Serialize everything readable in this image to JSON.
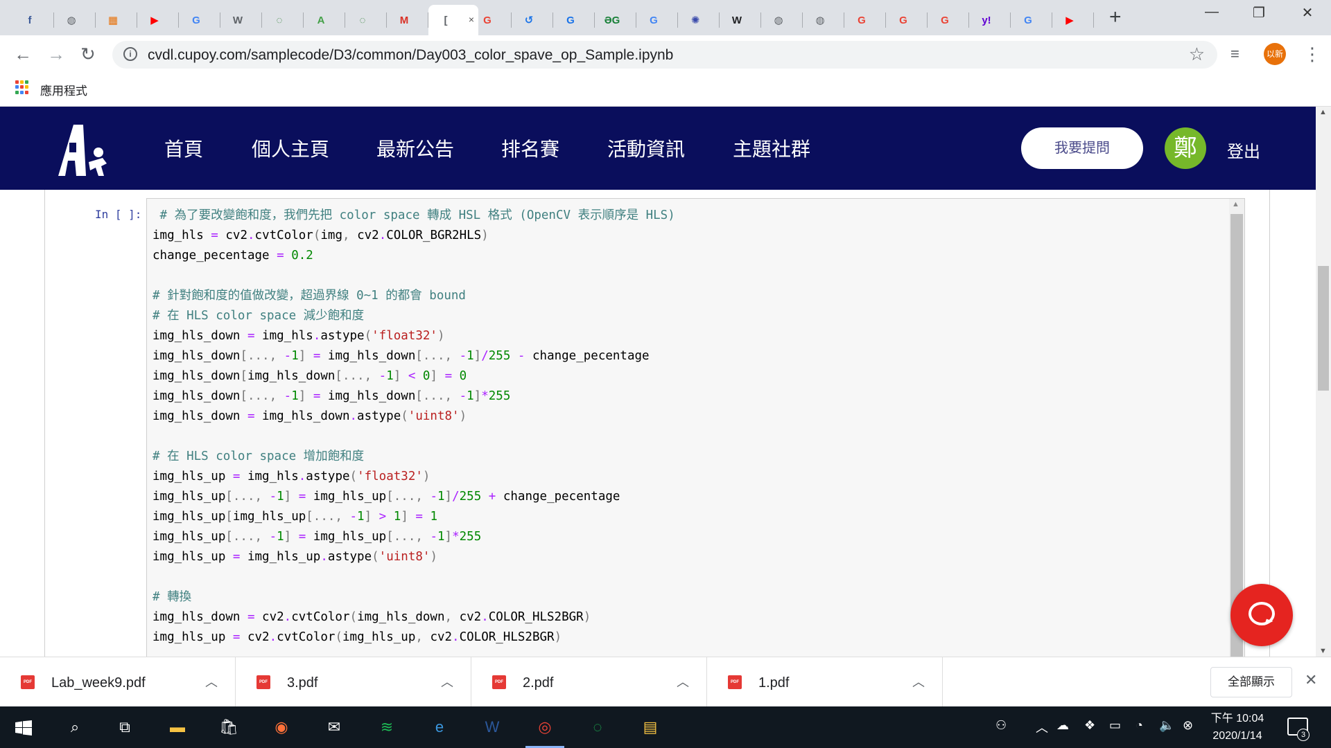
{
  "browser": {
    "tabs": [
      {
        "icon": "facebook-icon",
        "glyph": "f",
        "color": "#3b5998"
      },
      {
        "icon": "globe-icon",
        "glyph": "◍",
        "color": "#5f6368"
      },
      {
        "icon": "site-icon",
        "glyph": "▦",
        "color": "#e8710a"
      },
      {
        "icon": "youtube-icon",
        "glyph": "▶",
        "color": "#ff0000"
      },
      {
        "icon": "google-icon",
        "glyph": "G",
        "color": "#4285f4"
      },
      {
        "icon": "wordpress-icon",
        "glyph": "W",
        "color": "#5f6368"
      },
      {
        "icon": "ring-icon",
        "glyph": "◌",
        "color": "#2e7d32"
      },
      {
        "icon": "a-icon",
        "glyph": "A",
        "color": "#43a047"
      },
      {
        "icon": "ring-icon",
        "glyph": "◌",
        "color": "#2e7d32"
      },
      {
        "icon": "gmail-icon",
        "glyph": "M",
        "color": "#d93025"
      },
      {
        "icon": "active-tab-icon",
        "glyph": "[",
        "color": "#5f6368"
      },
      {
        "icon": "google-icon",
        "glyph": "G",
        "color": "#ea4335"
      },
      {
        "icon": "history-icon",
        "glyph": "↺",
        "color": "#1a73e8"
      },
      {
        "icon": "site-icon",
        "glyph": "G",
        "color": "#1a73e8"
      },
      {
        "icon": "translate-icon",
        "glyph": "ƏG",
        "color": "#188038"
      },
      {
        "icon": "google-icon",
        "glyph": "G",
        "color": "#4285f4"
      },
      {
        "icon": "settings-icon",
        "glyph": "✺",
        "color": "#3949ab"
      },
      {
        "icon": "wikipedia-icon",
        "glyph": "W",
        "color": "#202124"
      },
      {
        "icon": "globe-icon",
        "glyph": "◍",
        "color": "#5f6368"
      },
      {
        "icon": "globe-icon",
        "glyph": "◍",
        "color": "#5f6368"
      },
      {
        "icon": "google-icon",
        "glyph": "G",
        "color": "#ea4335"
      },
      {
        "icon": "google-icon",
        "glyph": "G",
        "color": "#ea4335"
      },
      {
        "icon": "google-icon",
        "glyph": "G",
        "color": "#ea4335"
      },
      {
        "icon": "yahoo-icon",
        "glyph": "y!",
        "color": "#6001d2"
      },
      {
        "icon": "google-icon",
        "glyph": "G",
        "color": "#4285f4"
      },
      {
        "icon": "youtube-icon",
        "glyph": "▶",
        "color": "#ff0000"
      }
    ],
    "active_tab_close": "×",
    "new_tab": "+",
    "url": "cvdl.cupoy.com/samplecode/D3/common/Day003_color_spave_op_Sample.ipynb",
    "profile_label": "以新",
    "bookmarks_apps_label": "應用程式"
  },
  "site": {
    "nav": [
      "首頁",
      "個人主頁",
      "最新公告",
      "排名賽",
      "活動資訊",
      "主題社群"
    ],
    "ask_button": "我要提問",
    "user_avatar": "鄭",
    "logout": "登出",
    "brand_color": "#0a0e5c"
  },
  "notebook": {
    "prompt": "In [ ]:",
    "code_lines": [
      [
        {
          "t": " # 為了要改變飽和度，我們先把 color space 轉成 HSL 格式 (OpenCV 表示順序是 HLS)",
          "c": "cm-c"
        }
      ],
      [
        {
          "t": "img_hls "
        },
        {
          "t": "=",
          "c": "cm-o"
        },
        {
          "t": " cv2"
        },
        {
          "t": ".",
          "c": "cm-o"
        },
        {
          "t": "cvtColor"
        },
        {
          "t": "(",
          "c": "cm-p"
        },
        {
          "t": "img"
        },
        {
          "t": ", ",
          "c": "cm-p"
        },
        {
          "t": "cv2"
        },
        {
          "t": ".",
          "c": "cm-o"
        },
        {
          "t": "COLOR_BGR2HLS"
        },
        {
          "t": ")",
          "c": "cm-p"
        }
      ],
      [
        {
          "t": "change_pecentage "
        },
        {
          "t": "=",
          "c": "cm-o"
        },
        {
          "t": " "
        },
        {
          "t": "0.2",
          "c": "cm-n"
        }
      ],
      [
        {
          "t": ""
        }
      ],
      [
        {
          "t": "# 針對飽和度的值做改變，超過界線 0~1 的都會 bound",
          "c": "cm-c"
        }
      ],
      [
        {
          "t": "# 在 HLS color space 減少飽和度",
          "c": "cm-c"
        }
      ],
      [
        {
          "t": "img_hls_down "
        },
        {
          "t": "=",
          "c": "cm-o"
        },
        {
          "t": " img_hls"
        },
        {
          "t": ".",
          "c": "cm-o"
        },
        {
          "t": "astype"
        },
        {
          "t": "(",
          "c": "cm-p"
        },
        {
          "t": "'float32'",
          "c": "cm-s"
        },
        {
          "t": ")",
          "c": "cm-p"
        }
      ],
      [
        {
          "t": "img_hls_down"
        },
        {
          "t": "[..., ",
          "c": "cm-p"
        },
        {
          "t": "-",
          "c": "cm-o"
        },
        {
          "t": "1",
          "c": "cm-n"
        },
        {
          "t": "]",
          "c": "cm-p"
        },
        {
          "t": " "
        },
        {
          "t": "=",
          "c": "cm-o"
        },
        {
          "t": " img_hls_down"
        },
        {
          "t": "[..., ",
          "c": "cm-p"
        },
        {
          "t": "-",
          "c": "cm-o"
        },
        {
          "t": "1",
          "c": "cm-n"
        },
        {
          "t": "]",
          "c": "cm-p"
        },
        {
          "t": "/",
          "c": "cm-o"
        },
        {
          "t": "255",
          "c": "cm-n"
        },
        {
          "t": " "
        },
        {
          "t": "-",
          "c": "cm-o"
        },
        {
          "t": " change_pecentage"
        }
      ],
      [
        {
          "t": "img_hls_down"
        },
        {
          "t": "[",
          "c": "cm-p"
        },
        {
          "t": "img_hls_down"
        },
        {
          "t": "[..., ",
          "c": "cm-p"
        },
        {
          "t": "-",
          "c": "cm-o"
        },
        {
          "t": "1",
          "c": "cm-n"
        },
        {
          "t": "]",
          "c": "cm-p"
        },
        {
          "t": " "
        },
        {
          "t": "<",
          "c": "cm-o"
        },
        {
          "t": " "
        },
        {
          "t": "0",
          "c": "cm-n"
        },
        {
          "t": "]",
          "c": "cm-p"
        },
        {
          "t": " "
        },
        {
          "t": "=",
          "c": "cm-o"
        },
        {
          "t": " "
        },
        {
          "t": "0",
          "c": "cm-n"
        }
      ],
      [
        {
          "t": "img_hls_down"
        },
        {
          "t": "[..., ",
          "c": "cm-p"
        },
        {
          "t": "-",
          "c": "cm-o"
        },
        {
          "t": "1",
          "c": "cm-n"
        },
        {
          "t": "]",
          "c": "cm-p"
        },
        {
          "t": " "
        },
        {
          "t": "=",
          "c": "cm-o"
        },
        {
          "t": " img_hls_down"
        },
        {
          "t": "[..., ",
          "c": "cm-p"
        },
        {
          "t": "-",
          "c": "cm-o"
        },
        {
          "t": "1",
          "c": "cm-n"
        },
        {
          "t": "]",
          "c": "cm-p"
        },
        {
          "t": "*",
          "c": "cm-o"
        },
        {
          "t": "255",
          "c": "cm-n"
        }
      ],
      [
        {
          "t": "img_hls_down "
        },
        {
          "t": "=",
          "c": "cm-o"
        },
        {
          "t": " img_hls_down"
        },
        {
          "t": ".",
          "c": "cm-o"
        },
        {
          "t": "astype"
        },
        {
          "t": "(",
          "c": "cm-p"
        },
        {
          "t": "'uint8'",
          "c": "cm-s"
        },
        {
          "t": ")",
          "c": "cm-p"
        }
      ],
      [
        {
          "t": ""
        }
      ],
      [
        {
          "t": "# 在 HLS color space 增加飽和度",
          "c": "cm-c"
        }
      ],
      [
        {
          "t": "img_hls_up "
        },
        {
          "t": "=",
          "c": "cm-o"
        },
        {
          "t": " img_hls"
        },
        {
          "t": ".",
          "c": "cm-o"
        },
        {
          "t": "astype"
        },
        {
          "t": "(",
          "c": "cm-p"
        },
        {
          "t": "'float32'",
          "c": "cm-s"
        },
        {
          "t": ")",
          "c": "cm-p"
        }
      ],
      [
        {
          "t": "img_hls_up"
        },
        {
          "t": "[..., ",
          "c": "cm-p"
        },
        {
          "t": "-",
          "c": "cm-o"
        },
        {
          "t": "1",
          "c": "cm-n"
        },
        {
          "t": "]",
          "c": "cm-p"
        },
        {
          "t": " "
        },
        {
          "t": "=",
          "c": "cm-o"
        },
        {
          "t": " img_hls_up"
        },
        {
          "t": "[..., ",
          "c": "cm-p"
        },
        {
          "t": "-",
          "c": "cm-o"
        },
        {
          "t": "1",
          "c": "cm-n"
        },
        {
          "t": "]",
          "c": "cm-p"
        },
        {
          "t": "/",
          "c": "cm-o"
        },
        {
          "t": "255",
          "c": "cm-n"
        },
        {
          "t": " "
        },
        {
          "t": "+",
          "c": "cm-o"
        },
        {
          "t": " change_pecentage"
        }
      ],
      [
        {
          "t": "img_hls_up"
        },
        {
          "t": "[",
          "c": "cm-p"
        },
        {
          "t": "img_hls_up"
        },
        {
          "t": "[..., ",
          "c": "cm-p"
        },
        {
          "t": "-",
          "c": "cm-o"
        },
        {
          "t": "1",
          "c": "cm-n"
        },
        {
          "t": "]",
          "c": "cm-p"
        },
        {
          "t": " "
        },
        {
          "t": ">",
          "c": "cm-o"
        },
        {
          "t": " "
        },
        {
          "t": "1",
          "c": "cm-n"
        },
        {
          "t": "]",
          "c": "cm-p"
        },
        {
          "t": " "
        },
        {
          "t": "=",
          "c": "cm-o"
        },
        {
          "t": " "
        },
        {
          "t": "1",
          "c": "cm-n"
        }
      ],
      [
        {
          "t": "img_hls_up"
        },
        {
          "t": "[..., ",
          "c": "cm-p"
        },
        {
          "t": "-",
          "c": "cm-o"
        },
        {
          "t": "1",
          "c": "cm-n"
        },
        {
          "t": "]",
          "c": "cm-p"
        },
        {
          "t": " "
        },
        {
          "t": "=",
          "c": "cm-o"
        },
        {
          "t": " img_hls_up"
        },
        {
          "t": "[..., ",
          "c": "cm-p"
        },
        {
          "t": "-",
          "c": "cm-o"
        },
        {
          "t": "1",
          "c": "cm-n"
        },
        {
          "t": "]",
          "c": "cm-p"
        },
        {
          "t": "*",
          "c": "cm-o"
        },
        {
          "t": "255",
          "c": "cm-n"
        }
      ],
      [
        {
          "t": "img_hls_up "
        },
        {
          "t": "=",
          "c": "cm-o"
        },
        {
          "t": " img_hls_up"
        },
        {
          "t": ".",
          "c": "cm-o"
        },
        {
          "t": "astype"
        },
        {
          "t": "(",
          "c": "cm-p"
        },
        {
          "t": "'uint8'",
          "c": "cm-s"
        },
        {
          "t": ")",
          "c": "cm-p"
        }
      ],
      [
        {
          "t": ""
        }
      ],
      [
        {
          "t": "# 轉換",
          "c": "cm-c"
        }
      ],
      [
        {
          "t": "img_hls_down "
        },
        {
          "t": "=",
          "c": "cm-o"
        },
        {
          "t": " cv2"
        },
        {
          "t": ".",
          "c": "cm-o"
        },
        {
          "t": "cvtColor"
        },
        {
          "t": "(",
          "c": "cm-p"
        },
        {
          "t": "img_hls_down"
        },
        {
          "t": ", ",
          "c": "cm-p"
        },
        {
          "t": "cv2"
        },
        {
          "t": ".",
          "c": "cm-o"
        },
        {
          "t": "COLOR_HLS2BGR"
        },
        {
          "t": ")",
          "c": "cm-p"
        }
      ],
      [
        {
          "t": "img_hls_up "
        },
        {
          "t": "=",
          "c": "cm-o"
        },
        {
          "t": " cv2"
        },
        {
          "t": ".",
          "c": "cm-o"
        },
        {
          "t": "cvtColor"
        },
        {
          "t": "(",
          "c": "cm-p"
        },
        {
          "t": "img_hls_up"
        },
        {
          "t": ", ",
          "c": "cm-p"
        },
        {
          "t": "cv2"
        },
        {
          "t": ".",
          "c": "cm-o"
        },
        {
          "t": "COLOR_HLS2BGR"
        },
        {
          "t": ")",
          "c": "cm-p"
        }
      ]
    ]
  },
  "downloads": {
    "items": [
      "Lab_week9.pdf",
      "3.pdf",
      "2.pdf",
      "1.pdf"
    ],
    "file_badge": "PDF",
    "show_all": "全部顯示"
  },
  "taskbar": {
    "time": "下午 10:04",
    "date": "2020/1/14",
    "notification_count": "3",
    "apps": [
      {
        "name": "file-explorer-icon",
        "glyph": "▬",
        "color": "#f6c343"
      },
      {
        "name": "store-icon",
        "glyph": "🛍",
        "color": "#fff"
      },
      {
        "name": "firefox-icon",
        "glyph": "◉",
        "color": "#ff7139"
      },
      {
        "name": "mail-icon",
        "glyph": "✉",
        "color": "#fff"
      },
      {
        "name": "spotify-icon",
        "glyph": "≋",
        "color": "#1db954"
      },
      {
        "name": "edge-icon",
        "glyph": "e",
        "color": "#3a96dd"
      },
      {
        "name": "word-icon",
        "glyph": "W",
        "color": "#2b579a"
      },
      {
        "name": "chrome-icon",
        "glyph": "◎",
        "color": "#ea4335"
      },
      {
        "name": "circle-app-icon",
        "glyph": "◌",
        "color": "#1db954"
      },
      {
        "name": "python-file-icon",
        "glyph": "▤",
        "color": "#f6c343"
      }
    ]
  }
}
